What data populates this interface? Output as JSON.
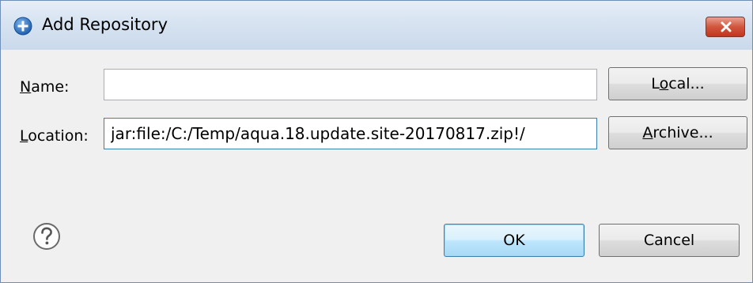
{
  "window": {
    "title": "Add Repository",
    "close_label": "×"
  },
  "form": {
    "name_label_mnemonic": "N",
    "name_label_rest": "ame:",
    "name_value": "",
    "location_label_mnemonic": "L",
    "location_label_rest": "ocation:",
    "location_value": "jar:file:/C:/Temp/aqua.18.update.site-20170817.zip!/"
  },
  "buttons": {
    "local_pre": "L",
    "local_mnemonic": "o",
    "local_post": "cal...",
    "archive_mnemonic": "A",
    "archive_post": "rchive...",
    "ok": "OK",
    "cancel": "Cancel"
  },
  "icons": {
    "title": "add-circle-icon",
    "help": "help-question-icon",
    "close": "close-icon"
  },
  "colors": {
    "title_gradient_top": "#e6eef8",
    "title_gradient_bottom": "#cad9ec",
    "close_red": "#c2351f",
    "dialog_bg": "#f0f0f0",
    "focus_border": "#3c7fb1",
    "default_button": "#bee6fd"
  }
}
